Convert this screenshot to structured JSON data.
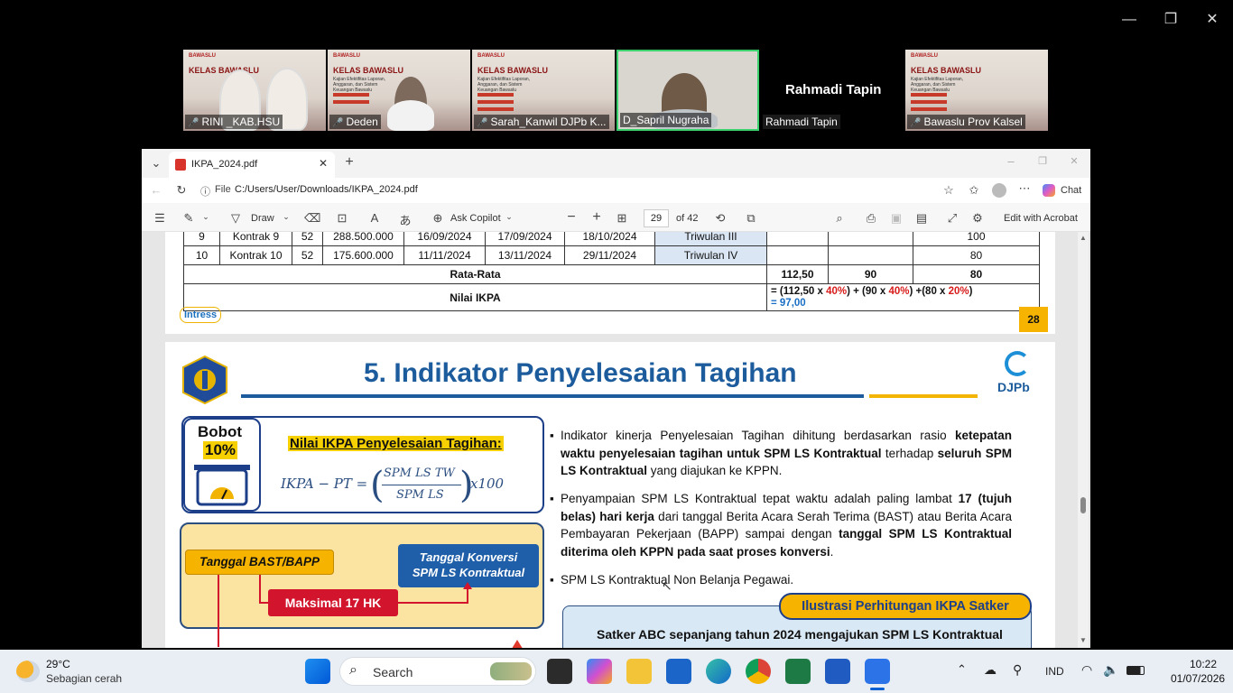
{
  "participants": [
    {
      "name": "RINI _KAB.HSU",
      "slide_logo": "BAWASLU",
      "slide_title": "KELAS BAWASLU"
    },
    {
      "name": "Deden",
      "slide_logo": "BAWASLU",
      "slide_title": "KELAS BAWASLU",
      "slide_sub": "Kajian Efektifitas Laporan, Anggaran, dan Sistem Keuangan Bawaslu"
    },
    {
      "name": "Sarah_Kanwil DJPb K...",
      "slide_logo": "BAWASLU",
      "slide_title": "KELAS BAWASLU",
      "slide_sub": "Kajian Efektifitas Laporan, Anggaran, dan Sistem Keuangan Bawaslu"
    },
    {
      "name": "D_Sapril Nugraha"
    },
    {
      "name": "Rahmadi Tapin",
      "big_name": "Rahmadi Tapin"
    },
    {
      "name": "Bawaslu Prov Kalsel",
      "slide_logo": "BAWASLU",
      "slide_title": "KELAS BAWASLU",
      "slide_sub": "Kajian Efektifitas Laporan, Anggaran, dan Sistem Keuangan Bawaslu"
    }
  ],
  "browser": {
    "tab_title": "IKPA_2024.pdf",
    "address_prefix": "File",
    "address": "C:/Users/User/Downloads/IKPA_2024.pdf",
    "chat_label": "Chat"
  },
  "pdf_toolbar": {
    "draw": "Draw",
    "ask_copilot": "Ask Copilot",
    "page_current": "29",
    "page_total": "of 42",
    "edit_acrobat": "Edit with Acrobat"
  },
  "page28": {
    "rows": [
      [
        "9",
        "Kontrak 9",
        "52",
        "288.500.000",
        "16/09/2024",
        "17/09/2024",
        "18/10/2024",
        "Triwulan III",
        "",
        "",
        "100"
      ],
      [
        "10",
        "Kontrak 10",
        "52",
        "175.600.000",
        "11/11/2024",
        "13/11/2024",
        "29/11/2024",
        "Triwulan IV",
        "",
        "",
        "80"
      ]
    ],
    "rata_label": "Rata-Rata",
    "rata_values": [
      "112,50",
      "90",
      "80"
    ],
    "nilai_label": "Nilai IKPA",
    "formula_line1_a": "= (112,50 x ",
    "formula_p1": "40%",
    "formula_line1_b": ") + (90 x ",
    "formula_p2": "40%",
    "formula_line1_c": ") +(80 x ",
    "formula_p3": "20%",
    "formula_line1_d": ")",
    "formula_line2": "= 97,00",
    "logo_text": "Intress",
    "page_number": "28"
  },
  "page29": {
    "title": "5. Indikator Penyelesaian Tagihan",
    "djpb_label": "DJPb",
    "bobot_label": "Bobot",
    "bobot_value": "10%",
    "nilai_title": "Nilai IKPA Penyelesaian Tagihan:",
    "formula_lhs": "IKPA − PT =",
    "formula_num": "SPM LS TW",
    "formula_den": "SPM LS",
    "formula_mult": "x100",
    "bast_label": "Tanggal BAST/BAPP",
    "konversi_label_1": "Tanggal Konversi",
    "konversi_label_2": "SPM LS Kontraktual",
    "maks_label": "Maksimal 17 HK",
    "bullet1_a": "Indikator kinerja Penyelesaian Tagihan dihitung berdasarkan rasio ",
    "bullet1_b": "ketepatan waktu penyelesaian tagihan untuk SPM LS Kontraktual",
    "bullet1_c": " terhadap ",
    "bullet1_d": "seluruh SPM LS Kontraktual",
    "bullet1_e": " yang diajukan ke KPPN.",
    "bullet2_a": "Penyampaian SPM LS Kontraktual tepat waktu adalah paling lambat ",
    "bullet2_b": "17 (tujuh belas) hari kerja",
    "bullet2_c": " dari tanggal Berita Acara Serah Terima (BAST) atau Berita Acara Pembayaran Pekerjaan (BAPP) sampai dengan ",
    "bullet2_d": "tanggal SPM LS Kontraktual diterima oleh KPPN pada saat proses konversi",
    "bullet2_e": ".",
    "bullet3": "SPM LS Kontraktual Non Belanja Pegawai.",
    "ilustrasi_label": "Ilustrasi Perhitungan IKPA Satker",
    "satker_text": "Satker ABC sepanjang tahun 2024 mengajukan SPM LS Kontraktual"
  },
  "taskbar": {
    "temp": "29°C",
    "weather": "Sebagian cerah",
    "search": "Search",
    "lang": "IND",
    "time": "10:22",
    "date": "01/07/2026"
  }
}
